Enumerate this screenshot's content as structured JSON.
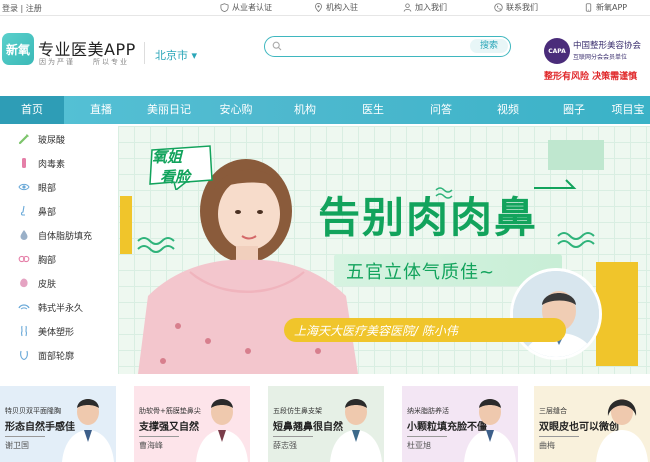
{
  "topbar": {
    "login": "登录",
    "sep": "|",
    "register": "注册",
    "links": [
      {
        "label": "从业者认证",
        "icon": "shield-icon"
      },
      {
        "label": "机构入驻",
        "icon": "location-icon"
      },
      {
        "label": "加入我们",
        "icon": "person-icon"
      },
      {
        "label": "联系我们",
        "icon": "phone-icon"
      },
      {
        "label": "新氧APP",
        "icon": "phone-device-icon"
      }
    ]
  },
  "header": {
    "logo_text": "新氧",
    "app_name": "专业医美APP",
    "slogan": "因为严谨　　所以专业",
    "city": "北京市",
    "city_caret": "▾",
    "search_placeholder": "",
    "search_button": "搜索",
    "capa_badge": "CAPA",
    "association": "中国整形美容协会",
    "association_sub": "互联网分会会员单位",
    "warning": "整形有风险 决策需谨慎"
  },
  "nav": [
    {
      "label": "首页",
      "active": true
    },
    {
      "label": "直播",
      "active": false
    },
    {
      "label": "美丽日记",
      "active": false
    },
    {
      "label": "安心购",
      "active": false
    },
    {
      "label": "机构",
      "active": false
    },
    {
      "label": "医生",
      "active": false
    },
    {
      "label": "问答",
      "active": false
    },
    {
      "label": "视频",
      "active": false
    },
    {
      "label": "圈子",
      "active": false
    },
    {
      "label": "项目宝",
      "active": false
    }
  ],
  "categories": [
    {
      "label": "玻尿酸",
      "icon": "syringe-icon",
      "color": "#7cc46b"
    },
    {
      "label": "肉毒素",
      "icon": "vial-icon",
      "color": "#e57fa8"
    },
    {
      "label": "眼部",
      "icon": "eye-icon",
      "color": "#6aa9d8"
    },
    {
      "label": "鼻部",
      "icon": "nose-icon",
      "color": "#6aa9d8"
    },
    {
      "label": "自体脂肪填充",
      "icon": "drop-icon",
      "color": "#9ab0c8"
    },
    {
      "label": "胸部",
      "icon": "chest-icon",
      "color": "#e57fa8"
    },
    {
      "label": "皮肤",
      "icon": "skin-icon",
      "color": "#e5a3c2"
    },
    {
      "label": "韩式半永久",
      "icon": "eyebrow-icon",
      "color": "#6aa9d8"
    },
    {
      "label": "美体塑形",
      "icon": "body-icon",
      "color": "#6aa9d8"
    },
    {
      "label": "面部轮廓",
      "icon": "face-icon",
      "color": "#6aa9d8"
    }
  ],
  "banner": {
    "bubble_line1": "氧姐",
    "bubble_line2": "看脸",
    "headline": "告别肉肉鼻",
    "subhead": "五官立体气质佳~",
    "doctor_line": "上海天大医疗美容医院/ 陈小伟"
  },
  "cards": [
    {
      "line1": "特贝贝双平面隆胸",
      "line2": "形态自然手感佳",
      "doctor": "谢卫国",
      "bg": "#e3eef8"
    },
    {
      "line1": "肋软骨+筋膜垫鼻尖",
      "line2": "支撑强又自然",
      "doctor": "曹海峰",
      "bg": "#fde4ea"
    },
    {
      "line1": "五段仿生鼻支架",
      "line2": "短鼻翘鼻很自然",
      "doctor": "薛志强",
      "bg": "#e6f0e6"
    },
    {
      "line1": "纳米脂肪养活",
      "line2": "小颗粒填充脸不僵",
      "doctor": "杜亚旭",
      "bg": "#f3e6f4"
    },
    {
      "line1": "三层缝合",
      "line2": "双眼皮也可以微创",
      "doctor": "曲梅",
      "bg": "#f9f1dc"
    }
  ],
  "colors": {
    "brand_teal": "#3fb7bf",
    "nav_bg": "#4fb9cf",
    "headline_green": "#12a35c",
    "warning_red": "#e0282a",
    "accent_yellow": "#f0c52b"
  }
}
